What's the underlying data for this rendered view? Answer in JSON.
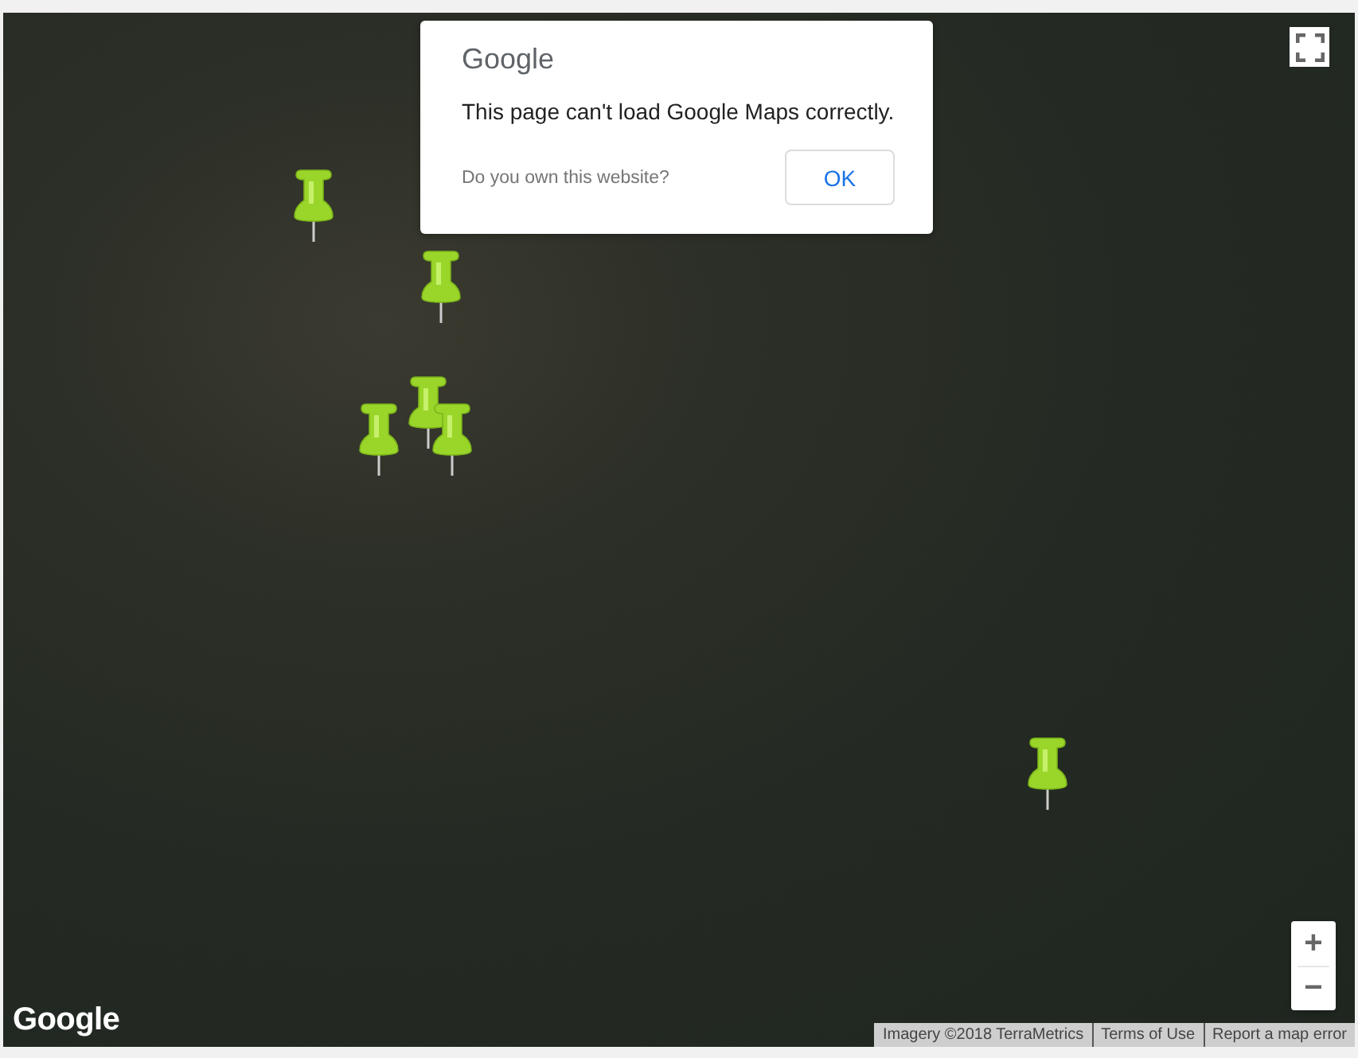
{
  "dialog": {
    "logo": "Google",
    "message": "This page can't load Google Maps correctly.",
    "link": "Do you own this website?",
    "button": "OK"
  },
  "map": {
    "logo": "Google",
    "zoom_in": "+",
    "zoom_out": "−"
  },
  "attribution": [
    "Imagery ©2018 TerraMetrics",
    "Terms of Use",
    "Report a map error"
  ]
}
